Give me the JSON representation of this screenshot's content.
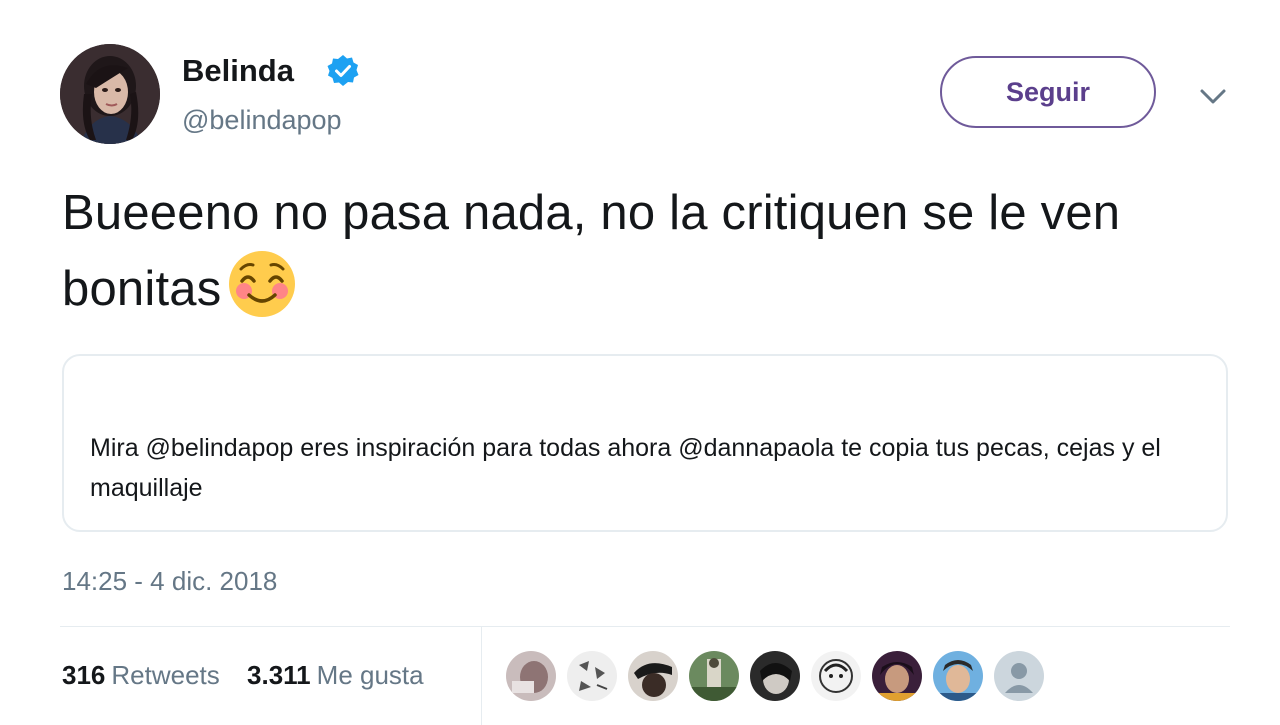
{
  "author": {
    "display_name": "Belinda",
    "handle": "@belindapop",
    "verified": true,
    "avatar_icon": "profile-photo"
  },
  "follow_button": {
    "label": "Seguir"
  },
  "menu_icon": "chevron-down-icon",
  "tweet": {
    "text": "Bueeeno no pasa nada, no la critiquen se le ven bonitas",
    "emoji": "smiling-face-with-smiling-eyes"
  },
  "quoted_tweet": {
    "text": "Mira @belindapop eres inspiración para todas ahora @dannapaola te copia tus pecas, cejas y el maquillaje"
  },
  "timestamp": "14:25 - 4 dic. 2018",
  "stats": {
    "retweets_count": "316",
    "retweets_label": "Retweets",
    "likes_count": "3.311",
    "likes_label": "Me gusta"
  },
  "colors": {
    "follow_border": "#6f5a9a",
    "verified_blue": "#1da1f2",
    "secondary_text": "#657786",
    "divider": "#e6ecf0"
  }
}
